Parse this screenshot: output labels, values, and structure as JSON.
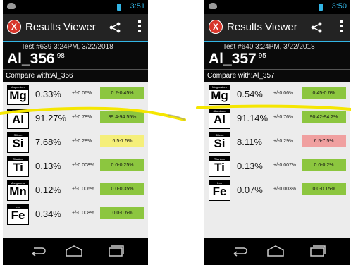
{
  "colors": {
    "accent": "#33b5e5",
    "range_green": "#8cc63f",
    "range_yellow": "#f5ef7a",
    "range_red": "#f0a0a0",
    "marker": "#f5e600"
  },
  "screens": [
    {
      "status_time": "3:51",
      "app_title": "Results Viewer",
      "test_info": "Test #639 3:24PM, 3/22/2018",
      "alloy": "Al_356",
      "score": "98",
      "compare_label": "Compare with:Al_356",
      "elements": [
        {
          "name": "Magnesium",
          "symbol": "Mg",
          "percent": "0.33%",
          "error": "+/-0.06%",
          "range": "0.2-0.45%",
          "status": "green"
        },
        {
          "name": "Aluminum",
          "symbol": "Al",
          "percent": "91.27%",
          "error": "+/-0.78%",
          "range": "89.4-94.55%",
          "status": "green"
        },
        {
          "name": "Silicon",
          "symbol": "Si",
          "percent": "7.68%",
          "error": "+/-0.28%",
          "range": "6.5-7.5%",
          "status": "yellow"
        },
        {
          "name": "Titanium",
          "symbol": "Ti",
          "percent": "0.13%",
          "error": "+/-0.008%",
          "range": "0.0-0.25%",
          "status": "green"
        },
        {
          "name": "Manganese",
          "symbol": "Mn",
          "percent": "0.12%",
          "error": "+/-0.006%",
          "range": "0.0-0.35%",
          "status": "green"
        },
        {
          "name": "Iron",
          "symbol": "Fe",
          "percent": "0.34%",
          "error": "+/-0.008%",
          "range": "0.0-0.6%",
          "status": "green"
        }
      ]
    },
    {
      "status_time": "3:50",
      "app_title": "Results Viewer",
      "test_info": "Test #640 3:24PM, 3/22/2018",
      "alloy": "Al_357",
      "score": "95",
      "compare_label": "Compare with:Al_357",
      "elements": [
        {
          "name": "Magnesium",
          "symbol": "Mg",
          "percent": "0.54%",
          "error": "+/-0.06%",
          "range": "0.45-0.6%",
          "status": "green"
        },
        {
          "name": "Aluminum",
          "symbol": "Al",
          "percent": "91.14%",
          "error": "+/-0.76%",
          "range": "90.42-94.2%",
          "status": "green"
        },
        {
          "name": "Silicon",
          "symbol": "Si",
          "percent": "8.11%",
          "error": "+/-0.29%",
          "range": "6.5-7.5%",
          "status": "red"
        },
        {
          "name": "Titanium",
          "symbol": "Ti",
          "percent": "0.13%",
          "error": "+/-0.007%",
          "range": "0.0-0.2%",
          "status": "green"
        },
        {
          "name": "Iron",
          "symbol": "Fe",
          "percent": "0.07%",
          "error": "+/-0.003%",
          "range": "0.0-0.15%",
          "status": "green"
        }
      ]
    }
  ]
}
